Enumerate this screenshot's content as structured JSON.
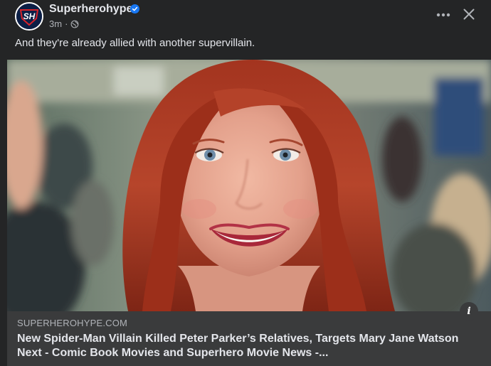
{
  "post": {
    "page_name": "Superherohype",
    "avatar_initials": "SH",
    "timestamp": "3m",
    "separator": "·",
    "text": "And they're already allied with another supervillain.",
    "image_alt": "Smiling woman with red hair in a school cafeteria",
    "link": {
      "domain": "SUPERHEROHYPE.COM",
      "title": "New Spider-Man Villain Killed Peter Parker’s Relatives, Targets Mary Jane Watson Next - Comic Book Movies and Superhero Movie News -..."
    },
    "info_label": "i"
  },
  "icons": {
    "verified": "verified-badge-icon",
    "audience": "globe-icon",
    "more": "more-horizontal-icon",
    "close": "close-icon",
    "info": "info-icon"
  },
  "colors": {
    "card_background": "#242526",
    "link_background": "#3a3b3c",
    "primary_text": "#e4e6eb",
    "secondary_text": "#b0b3b8",
    "verified_blue": "#1877f2",
    "avatar_navy": "#0c1f46",
    "avatar_red": "#d8232a"
  }
}
